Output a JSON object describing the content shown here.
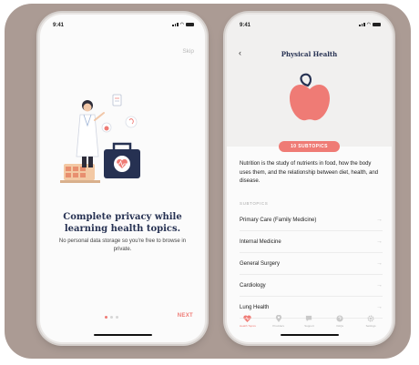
{
  "onboarding": {
    "time": "9:41",
    "skip_label": "Skip",
    "headline": "Complete privacy while learning health topics.",
    "subtext": "No personal data storage so you're free to browse in private.",
    "next_label": "NEXT",
    "page_count": 3,
    "current_page": 1
  },
  "topic": {
    "time": "9:41",
    "title": "Physical Health",
    "subtopic_count_label": "10 SUBTOPICS",
    "description": "Nutrition is the study of nutrients in food, how the body uses them, and the relationship between diet, health, and disease.",
    "section_label": "SUBTOPICS",
    "subtopics": [
      "Primary Care (Family Medicine)",
      "Internal Medicine",
      "General Surgery",
      "Cardiology",
      "Lung Health"
    ],
    "tabs": [
      {
        "label": "Health Topics",
        "icon": "heart-pulse-icon",
        "active": true
      },
      {
        "label": "Providers",
        "icon": "location-pin-icon",
        "active": false
      },
      {
        "label": "Support",
        "icon": "chat-bubble-icon",
        "active": false
      },
      {
        "label": "FAQs",
        "icon": "question-icon",
        "active": false
      },
      {
        "label": "Settings",
        "icon": "gear-icon",
        "active": false
      }
    ]
  },
  "colors": {
    "accent": "#ef7b75",
    "navy": "#263152",
    "frame": "#ab9b94"
  }
}
